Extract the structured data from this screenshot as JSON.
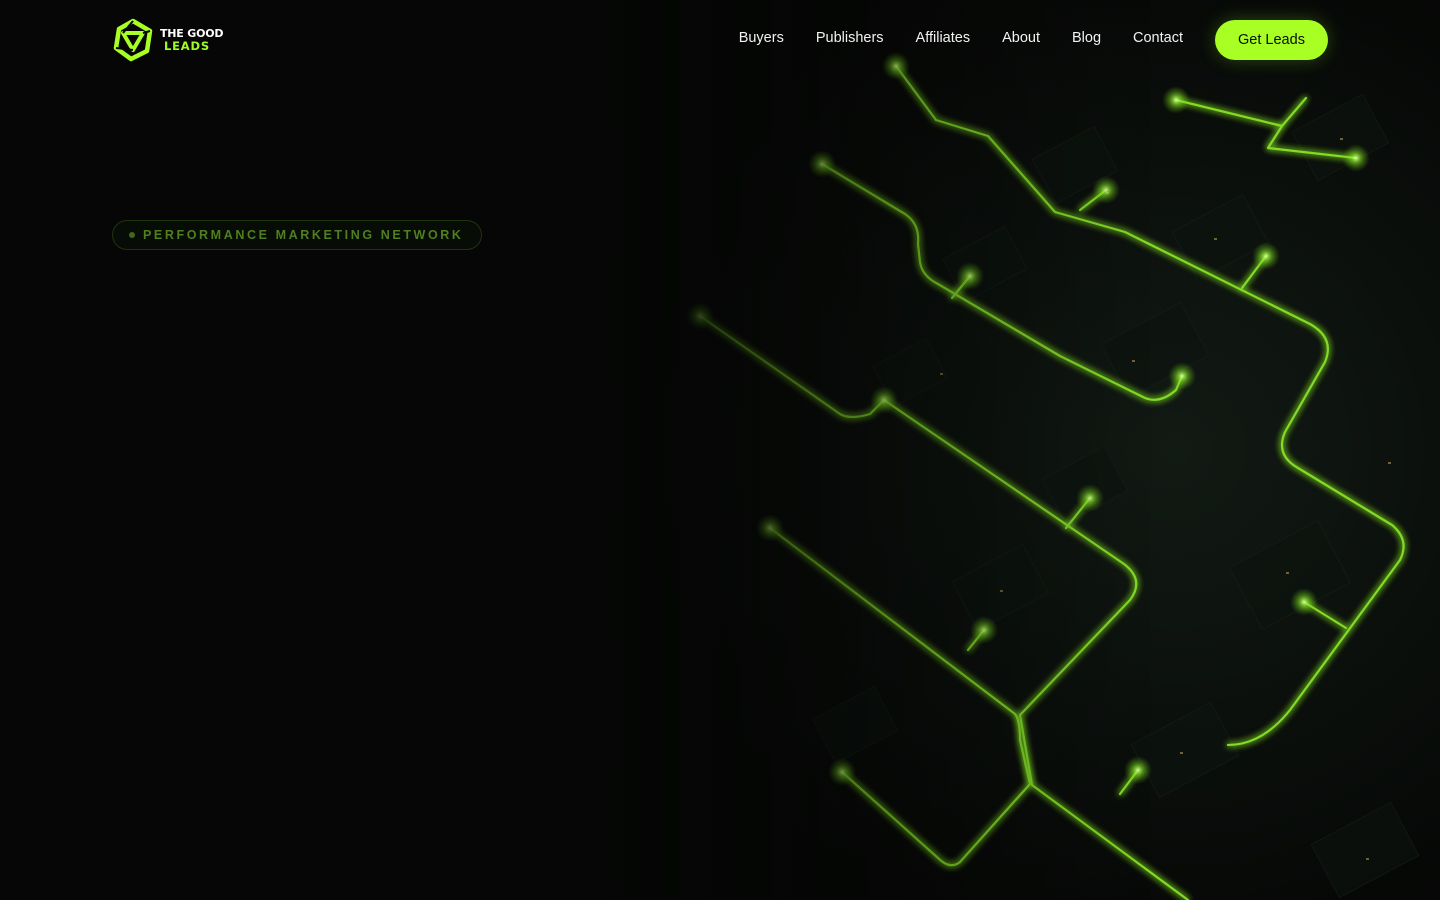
{
  "brand": {
    "line1": "THE GOOD",
    "line2": "LEADS",
    "accent": "#a8ff24"
  },
  "nav": {
    "items": [
      {
        "label": "Buyers"
      },
      {
        "label": "Publishers"
      },
      {
        "label": "Affiliates"
      },
      {
        "label": "About"
      },
      {
        "label": "Blog"
      },
      {
        "label": "Contact"
      }
    ],
    "cta_label": "Get Leads"
  },
  "hero": {
    "badge_text": "PERFORMANCE MARKETING NETWORK",
    "background": "night aerial map with glowing green network lines"
  },
  "icons": {
    "logo": "triangular-swirl-logo-icon",
    "badge": "dot-icon"
  }
}
